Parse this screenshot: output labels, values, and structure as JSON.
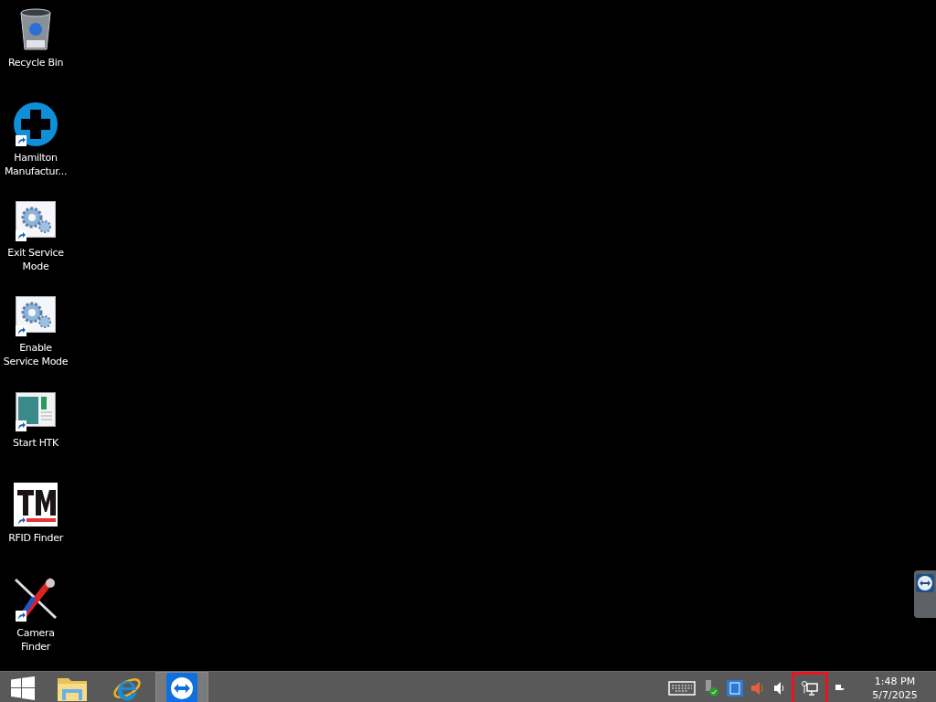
{
  "desktop_icons": [
    {
      "kind": "recycle-bin",
      "label": "Recycle Bin",
      "shortcut": false
    },
    {
      "kind": "plus",
      "label": "Hamilton Manufactur...",
      "shortcut": true
    },
    {
      "kind": "gears",
      "label": "Exit Service Mode",
      "shortcut": true
    },
    {
      "kind": "gears",
      "label": "Enable Service Mode",
      "shortcut": true
    },
    {
      "kind": "window",
      "label": "Start HTK",
      "shortcut": true
    },
    {
      "kind": "tm",
      "label": "RFID Finder",
      "shortcut": true
    },
    {
      "kind": "tools",
      "label": "Camera Finder",
      "shortcut": true
    }
  ],
  "taskbar": {
    "apps": [
      {
        "kind": "folder",
        "selected": false
      },
      {
        "kind": "browser",
        "selected": false
      },
      {
        "kind": "remote",
        "selected": true
      }
    ],
    "tray": [
      {
        "kind": "keyboard",
        "highlighted": false
      },
      {
        "kind": "usb",
        "highlighted": false
      },
      {
        "kind": "app",
        "highlighted": false
      },
      {
        "kind": "speaker",
        "highlighted": false
      },
      {
        "kind": "volume",
        "highlighted": false
      },
      {
        "kind": "network",
        "highlighted": true
      },
      {
        "kind": "flag",
        "highlighted": false
      }
    ],
    "clock": {
      "time": "1:48 PM",
      "date": "5/7/2025"
    }
  }
}
